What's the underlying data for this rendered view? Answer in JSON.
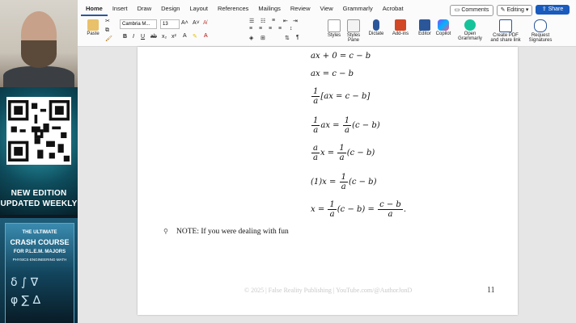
{
  "ribbon": {
    "tabs": [
      "Home",
      "Insert",
      "Draw",
      "Design",
      "Layout",
      "References",
      "Mailings",
      "Review",
      "View",
      "Grammarly",
      "Acrobat"
    ],
    "paste_label": "Paste",
    "font_name": "Cambria M...",
    "font_size": "13",
    "styles_label": "Styles",
    "styles_pane_label": "Styles Pane",
    "dictate_label": "Dictate",
    "addins_label": "Add-ins",
    "editor_label": "Editor",
    "copilot_label": "Copilot",
    "grammarly_label": "Open Grammarly",
    "create_pdf_label": "Create PDF and share link",
    "request_sig_label": "Request Signatures",
    "comments_label": "Comments",
    "editing_label": "Editing",
    "share_label": "Share",
    "accent": "#2b579a"
  },
  "promo": {
    "line1": "NEW EDITION",
    "line2": "UPDATED WEEKLY",
    "book_title_1": "THE ULTIMATE",
    "book_title_2": "CRASH COURSE",
    "book_title_3": "FOR P.L.E.M. MAJORS",
    "book_subtitle": "PHYSICS·ENGINEERING·MATH"
  },
  "document": {
    "eq1": "ax + 0 = c − b",
    "eq2": "ax = c − b",
    "eq3_rest": "[ax = c − b]",
    "eq4_rest": "ax =",
    "eq4_tail": "(c − b)",
    "eq5_tail": "(c − b)",
    "eq6_head": "(1)x =",
    "eq6_tail": "(c − b)",
    "eq7_head": "x =",
    "eq7_mid": "(c − b) =",
    "eq7_num": "c − b",
    "eq7_den": "a",
    "one": "1",
    "a": "a",
    "x_eq": "x =",
    "period": ".",
    "note": "NOTE: If you were dealing with fun",
    "footer": "© 2025 | False Reality Publishing | YouTube.com/@AuthorJonD",
    "page_number": "11"
  }
}
